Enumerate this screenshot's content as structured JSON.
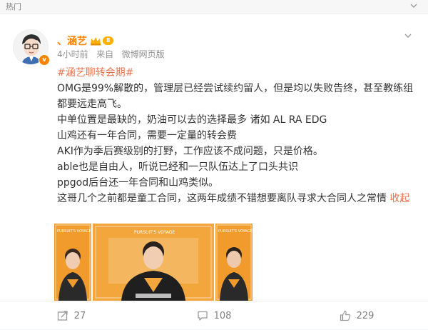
{
  "topbar": {
    "tag": "热门"
  },
  "post": {
    "author": "、涵艺",
    "vip_badge": "Ⅱ",
    "verified_icon": "v",
    "time": "4小时前",
    "source_prefix": "来自",
    "source": "微博网页版",
    "topic": "#涵艺聊转会期#",
    "lines": [
      "OMG是99%解散的，管理层已经尝试续约留人，但是均以失败告终，甚至教练组都要远走高飞。",
      "中单位置是最缺的，奶油可以去的选择最多 诸如 AL RA EDG",
      "山鸡还有一年合同，需要一定量的转会费",
      "AKI作为季后赛级别的打野，工作应该不成问题，只是价格。",
      "able也是自由人，听说已经和一只队伍达上了口头共识",
      "ppgod后台还一年合同和山鸡类似。",
      "这哥几个之前都是童工合同，这两年成绩不错想要离队寻求大合同人之常情"
    ],
    "collapse_label": "收起",
    "poster_text": "PURSUIT'S VOYAGE"
  },
  "actions": {
    "repost": "27",
    "comment": "108",
    "like": "229"
  },
  "colors": {
    "accent": "#ff8200",
    "link": "#eb7350",
    "poster_orange": "#f19b2c"
  },
  "icons": [
    "chevron-down-icon",
    "more-icon",
    "crown-icon",
    "repost-icon",
    "comment-icon",
    "like-icon"
  ]
}
